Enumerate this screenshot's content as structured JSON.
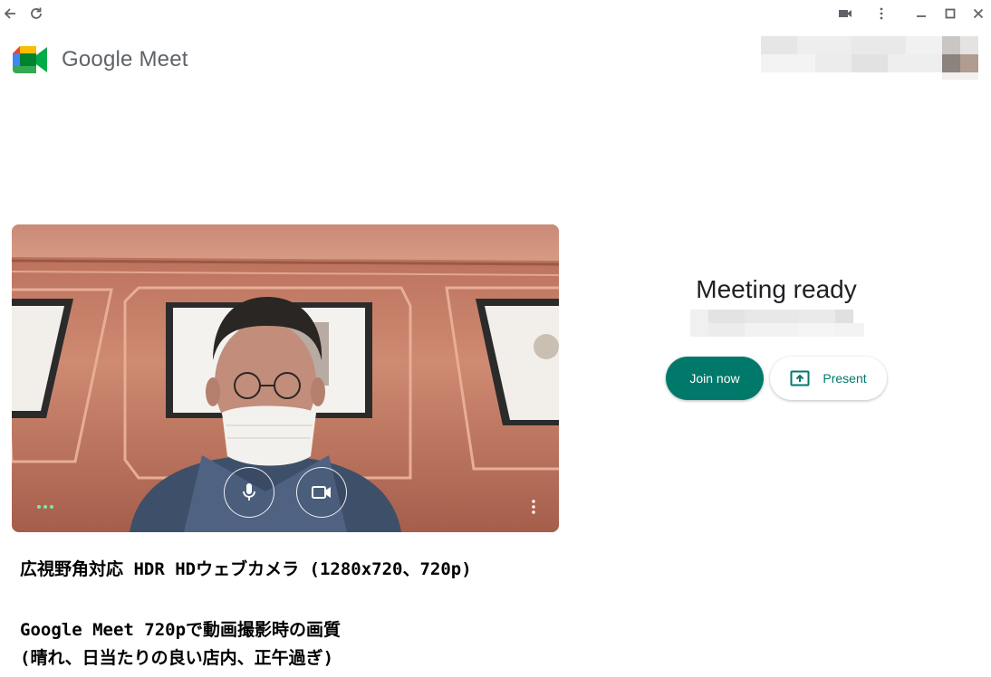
{
  "titlebar": {
    "icons": [
      "back-arrow-icon",
      "reload-icon",
      "camera-icon",
      "more-vert-icon",
      "minimize-icon",
      "maximize-icon",
      "close-icon"
    ]
  },
  "brand": {
    "name": "Google Meet",
    "colors": {
      "blue": "#4285F4",
      "green": "#34A853",
      "yellow": "#FBBC04",
      "red": "#EA4335",
      "teal": "#00796B"
    }
  },
  "preview": {
    "controls": [
      "microphone-icon",
      "videocam-icon"
    ],
    "audio_indicator": "audio-level-dots-icon",
    "more_options": "more-vert-icon"
  },
  "meeting": {
    "status_title": "Meeting ready",
    "join_label": "Join now",
    "present_label": "Present"
  },
  "caption": {
    "line1": "広視野角対応 HDR HDウェブカメラ (1280x720、720p)",
    "line2": "Google Meet 720pで動画撮影時の画質",
    "line3": "(晴れ、日当たりの良い店内、正午過ぎ)"
  }
}
